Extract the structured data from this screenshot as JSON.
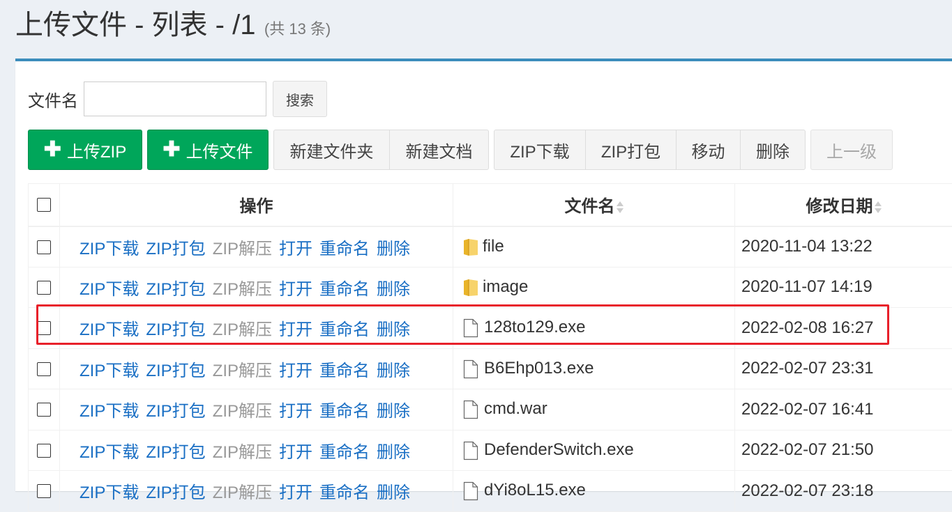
{
  "page": {
    "title": "上传文件 - 列表 - /1",
    "count": "(共 13 条)"
  },
  "search": {
    "label": "文件名",
    "value": "",
    "placeholder": "",
    "button": "搜索"
  },
  "toolbar": {
    "upload_zip": "上传ZIP",
    "upload_file": "上传文件",
    "new_folder": "新建文件夹",
    "new_doc": "新建文档",
    "zip_download": "ZIP下载",
    "zip_pack": "ZIP打包",
    "move": "移动",
    "delete": "删除",
    "up_level": "上一级"
  },
  "table": {
    "headers": {
      "ops": "操作",
      "name": "文件名",
      "date": "修改日期"
    },
    "ops": [
      "ZIP下载",
      "ZIP打包",
      "ZIP解压",
      "打开",
      "重命名",
      "删除"
    ],
    "rows": [
      {
        "type": "folder",
        "name": "file",
        "date": "2020-11-04 13:22"
      },
      {
        "type": "folder",
        "name": "image",
        "date": "2020-11-07 14:19"
      },
      {
        "type": "file",
        "name": "128to129.exe",
        "date": "2022-02-08 16:27",
        "highlighted": true
      },
      {
        "type": "file",
        "name": "B6Ehp013.exe",
        "date": "2022-02-07 23:31"
      },
      {
        "type": "file",
        "name": "cmd.war",
        "date": "2022-02-07 16:41"
      },
      {
        "type": "file",
        "name": "DefenderSwitch.exe",
        "date": "2022-02-07 21:50"
      },
      {
        "type": "file",
        "name": "dYi8oL15.exe",
        "date": "2022-02-07 23:18"
      }
    ]
  },
  "colors": {
    "accent": "#3c8dbc",
    "success": "#00a65a",
    "link": "#1a6fc4",
    "highlight_border": "#e8202a"
  }
}
